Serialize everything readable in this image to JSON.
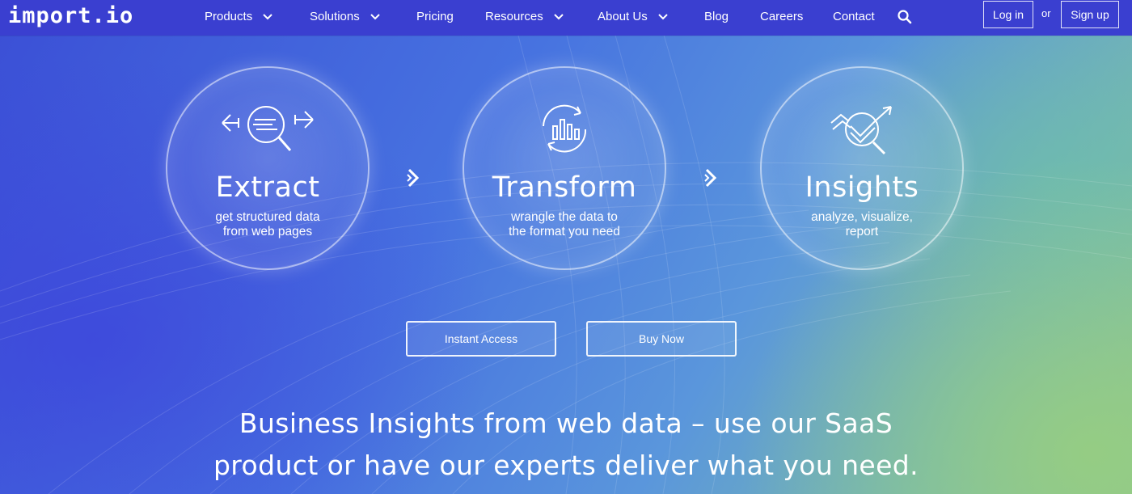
{
  "brand": {
    "logo_text": "import.io"
  },
  "nav": {
    "items": [
      {
        "label": "Products",
        "has_dropdown": true
      },
      {
        "label": "Solutions",
        "has_dropdown": true
      },
      {
        "label": "Pricing",
        "has_dropdown": false
      },
      {
        "label": "Resources",
        "has_dropdown": true
      },
      {
        "label": "About Us",
        "has_dropdown": true
      },
      {
        "label": "Blog",
        "has_dropdown": false
      },
      {
        "label": "Careers",
        "has_dropdown": false
      },
      {
        "label": "Contact",
        "has_dropdown": false
      }
    ],
    "search_icon": "search-icon",
    "login_label": "Log in",
    "or_label": "or",
    "signup_label": "Sign up"
  },
  "steps": [
    {
      "title": "Extract",
      "line1": "get structured data",
      "line2": "from web pages",
      "icon": "extract-magnifier-icon"
    },
    {
      "title": "Transform",
      "line1": "wrangle the data to",
      "line2": "the format you need",
      "icon": "transform-chart-cycle-icon"
    },
    {
      "title": "Insights",
      "line1": "analyze, visualize,",
      "line2": "report",
      "icon": "insights-trend-icon"
    }
  ],
  "cta": {
    "instant_access": "Instant Access",
    "buy_now": "Buy Now"
  },
  "headline": {
    "line1": "Business Insights from web data – use our SaaS",
    "line2": "product or have our experts deliver what you need."
  },
  "colors": {
    "nav_bg": "#3a3fd0",
    "text": "#ffffff",
    "gradient_start": "#3b4fd6",
    "gradient_end": "#8cc596"
  }
}
